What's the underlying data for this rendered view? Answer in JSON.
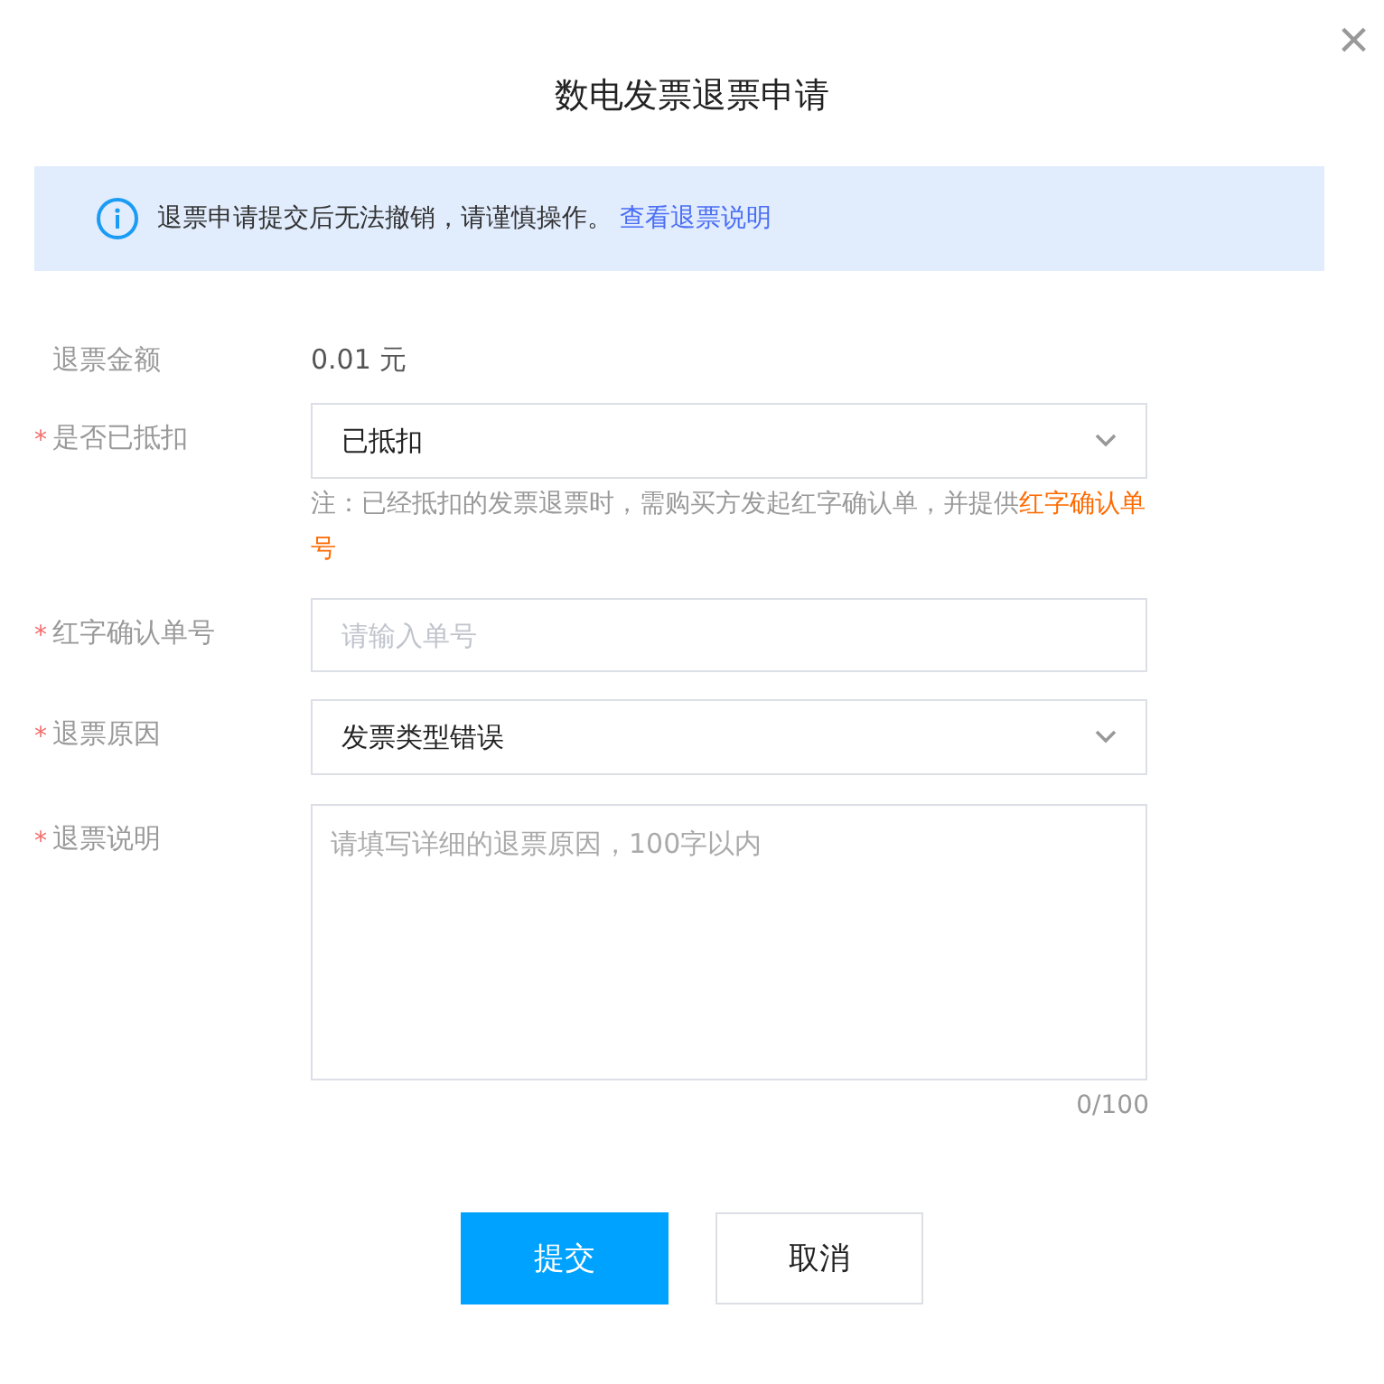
{
  "dialog": {
    "title": "数电发票退票申请",
    "close": "×"
  },
  "notice": {
    "text": "退票申请提交后无法撤销，请谨慎操作。",
    "link": "查看退票说明"
  },
  "fields": [
    {
      "kind": "text",
      "label": "退票金额",
      "value": "0.01 元"
    },
    {
      "kind": "select",
      "label": "是否已抵扣",
      "required_mark": "*",
      "value": "已抵扣",
      "note": {
        "text": "注：已经抵扣的发票退票时，需购买方发起红字确认单，并提供",
        "highlight": "红字确认单号"
      }
    },
    {
      "kind": "input",
      "label": "红字确认单号",
      "required_mark": "*",
      "placeholder": "请输入单号"
    },
    {
      "kind": "select",
      "label": "退票原因",
      "required_mark": "*",
      "value": "发票类型错误"
    },
    {
      "kind": "textarea",
      "label": "退票说明",
      "required_mark": "*",
      "placeholder": "请填写详细的退票原因，100字以内",
      "counter": "0/100"
    }
  ],
  "buttons": [
    {
      "label": "提交",
      "primary": true
    },
    {
      "label": "取消",
      "primary": false
    }
  ]
}
